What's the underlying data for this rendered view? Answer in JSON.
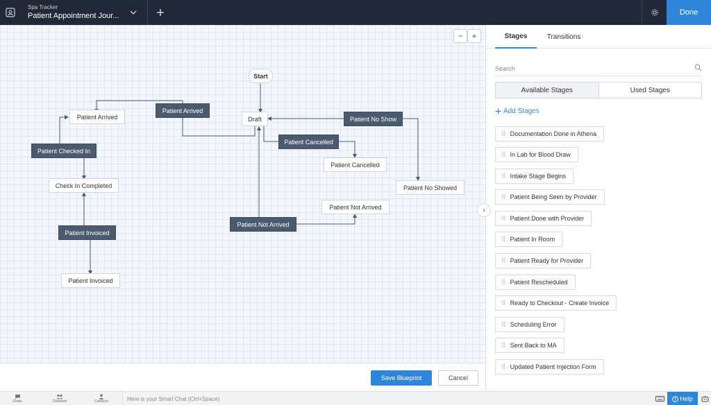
{
  "header": {
    "module": "Spa Tracker",
    "title": "Patient Appointment Jour...",
    "done_label": "Done"
  },
  "canvas": {
    "zoom_out": "−",
    "zoom_in": "+",
    "nodes": {
      "start": "Start",
      "draft": "Draft",
      "patient_arrived_stage": "Patient Arrived",
      "patient_arrived_transition": "Patient Arrived",
      "patient_checked_in": "Patient Checked In",
      "check_in_completed": "Check In Completed",
      "patient_invoiced_transition": "Patient Invoiced",
      "patient_invoiced_stage": "Patient Invoiced",
      "patient_no_show": "Patient No Show",
      "patient_cancelled_transition": "Patient Cancelled",
      "patient_cancelled_stage": "Patient Cancelled",
      "patient_no_showed": "Patient No Showed",
      "patient_not_arrived_stage": "Patient Not Arrived",
      "patient_not_arrived_transition": "Patient Not Arrived"
    },
    "save_label": "Save Blueprint",
    "cancel_label": "Cancel"
  },
  "panel": {
    "tabs": [
      "Stages",
      "Transitions"
    ],
    "search_placeholder": "Search",
    "segments": [
      "Available Stages",
      "Used Stages"
    ],
    "add_stages": "Add Stages",
    "stages": [
      "Documentation Done in Athena",
      "In Lab for Blood Draw",
      "Intake Stage Begins",
      "Patient Being Seen by Provider",
      "Patient Done with Provider",
      "Patient In Room",
      "Patient Ready for Provider",
      "Patient Rescheduled",
      "Ready to Checkout - Create Invoice",
      "Scheduling Error",
      "Sent Back to MA",
      "Updated Patient Injection Form"
    ]
  },
  "statusbar": {
    "chats": "Chats",
    "channels": "Channels",
    "contacts": "Contacts",
    "chat_placeholder": "Here is your Smart Chat (Ctrl+Space)",
    "help": "Help"
  },
  "colors": {
    "topbar": "#212938",
    "accent": "#2f86d8",
    "transition_node": "#4b5a6e"
  }
}
